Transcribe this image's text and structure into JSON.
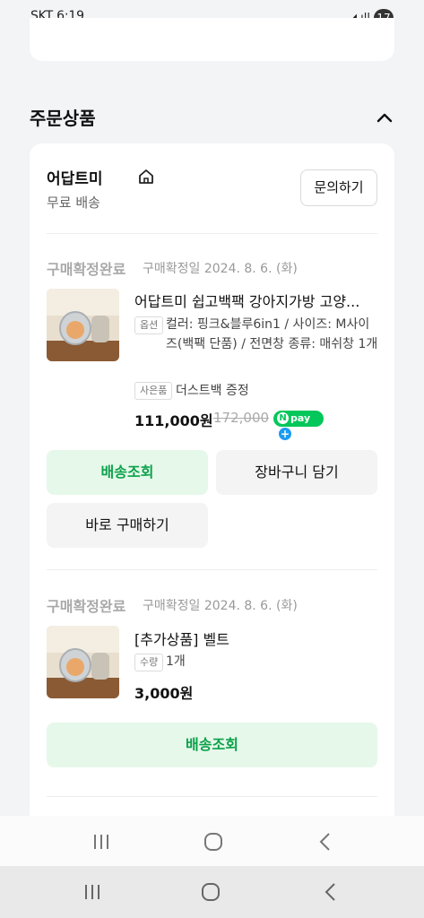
{
  "status_bar": {
    "left": "SKT 6:19",
    "right": "17"
  },
  "section": {
    "title": "주문상품"
  },
  "seller": {
    "name": "어답트미",
    "shipping": "무료 배송",
    "inquiry_button": "문의하기"
  },
  "orders": [
    {
      "status": "구매확정완료",
      "date": "구매확정일 2024. 8. 6. (화)",
      "product_name": "어답트미 쉽고백팩 강아지가방 고양...",
      "option_tag": "옵션",
      "option_text": "컬러: 핑크&블루6in1 / 사이즈: M사이즈(백팩 단품) / 전면창 종류: 매쉬창 1개",
      "gift_tag": "사은품",
      "gift_text": "더스트백 증정",
      "price": "111,000원",
      "original_price": "172,000",
      "pay_badge": "pay",
      "buttons": {
        "delivery": "배송조회",
        "cart": "장바구니 담기",
        "buy_now": "바로 구매하기"
      }
    },
    {
      "status": "구매확정완료",
      "date": "구매확정일 2024. 8. 6. (화)",
      "product_name": "[추가상품] 벨트",
      "qty_tag": "수량",
      "qty_text": "1개",
      "price": "3,000원",
      "buttons": {
        "delivery": "배송조회"
      }
    }
  ],
  "icons": {
    "collapse": "chevron-up-icon",
    "seller_home": "home-icon",
    "nav_recent": "recent-apps-icon",
    "nav_home": "home-circle-icon",
    "nav_back": "back-icon"
  },
  "colors": {
    "accent": "#03c75a",
    "button_green_bg": "#e6f8ea",
    "button_green_text": "#0ba14a",
    "status_gray": "#a9a9a9"
  }
}
